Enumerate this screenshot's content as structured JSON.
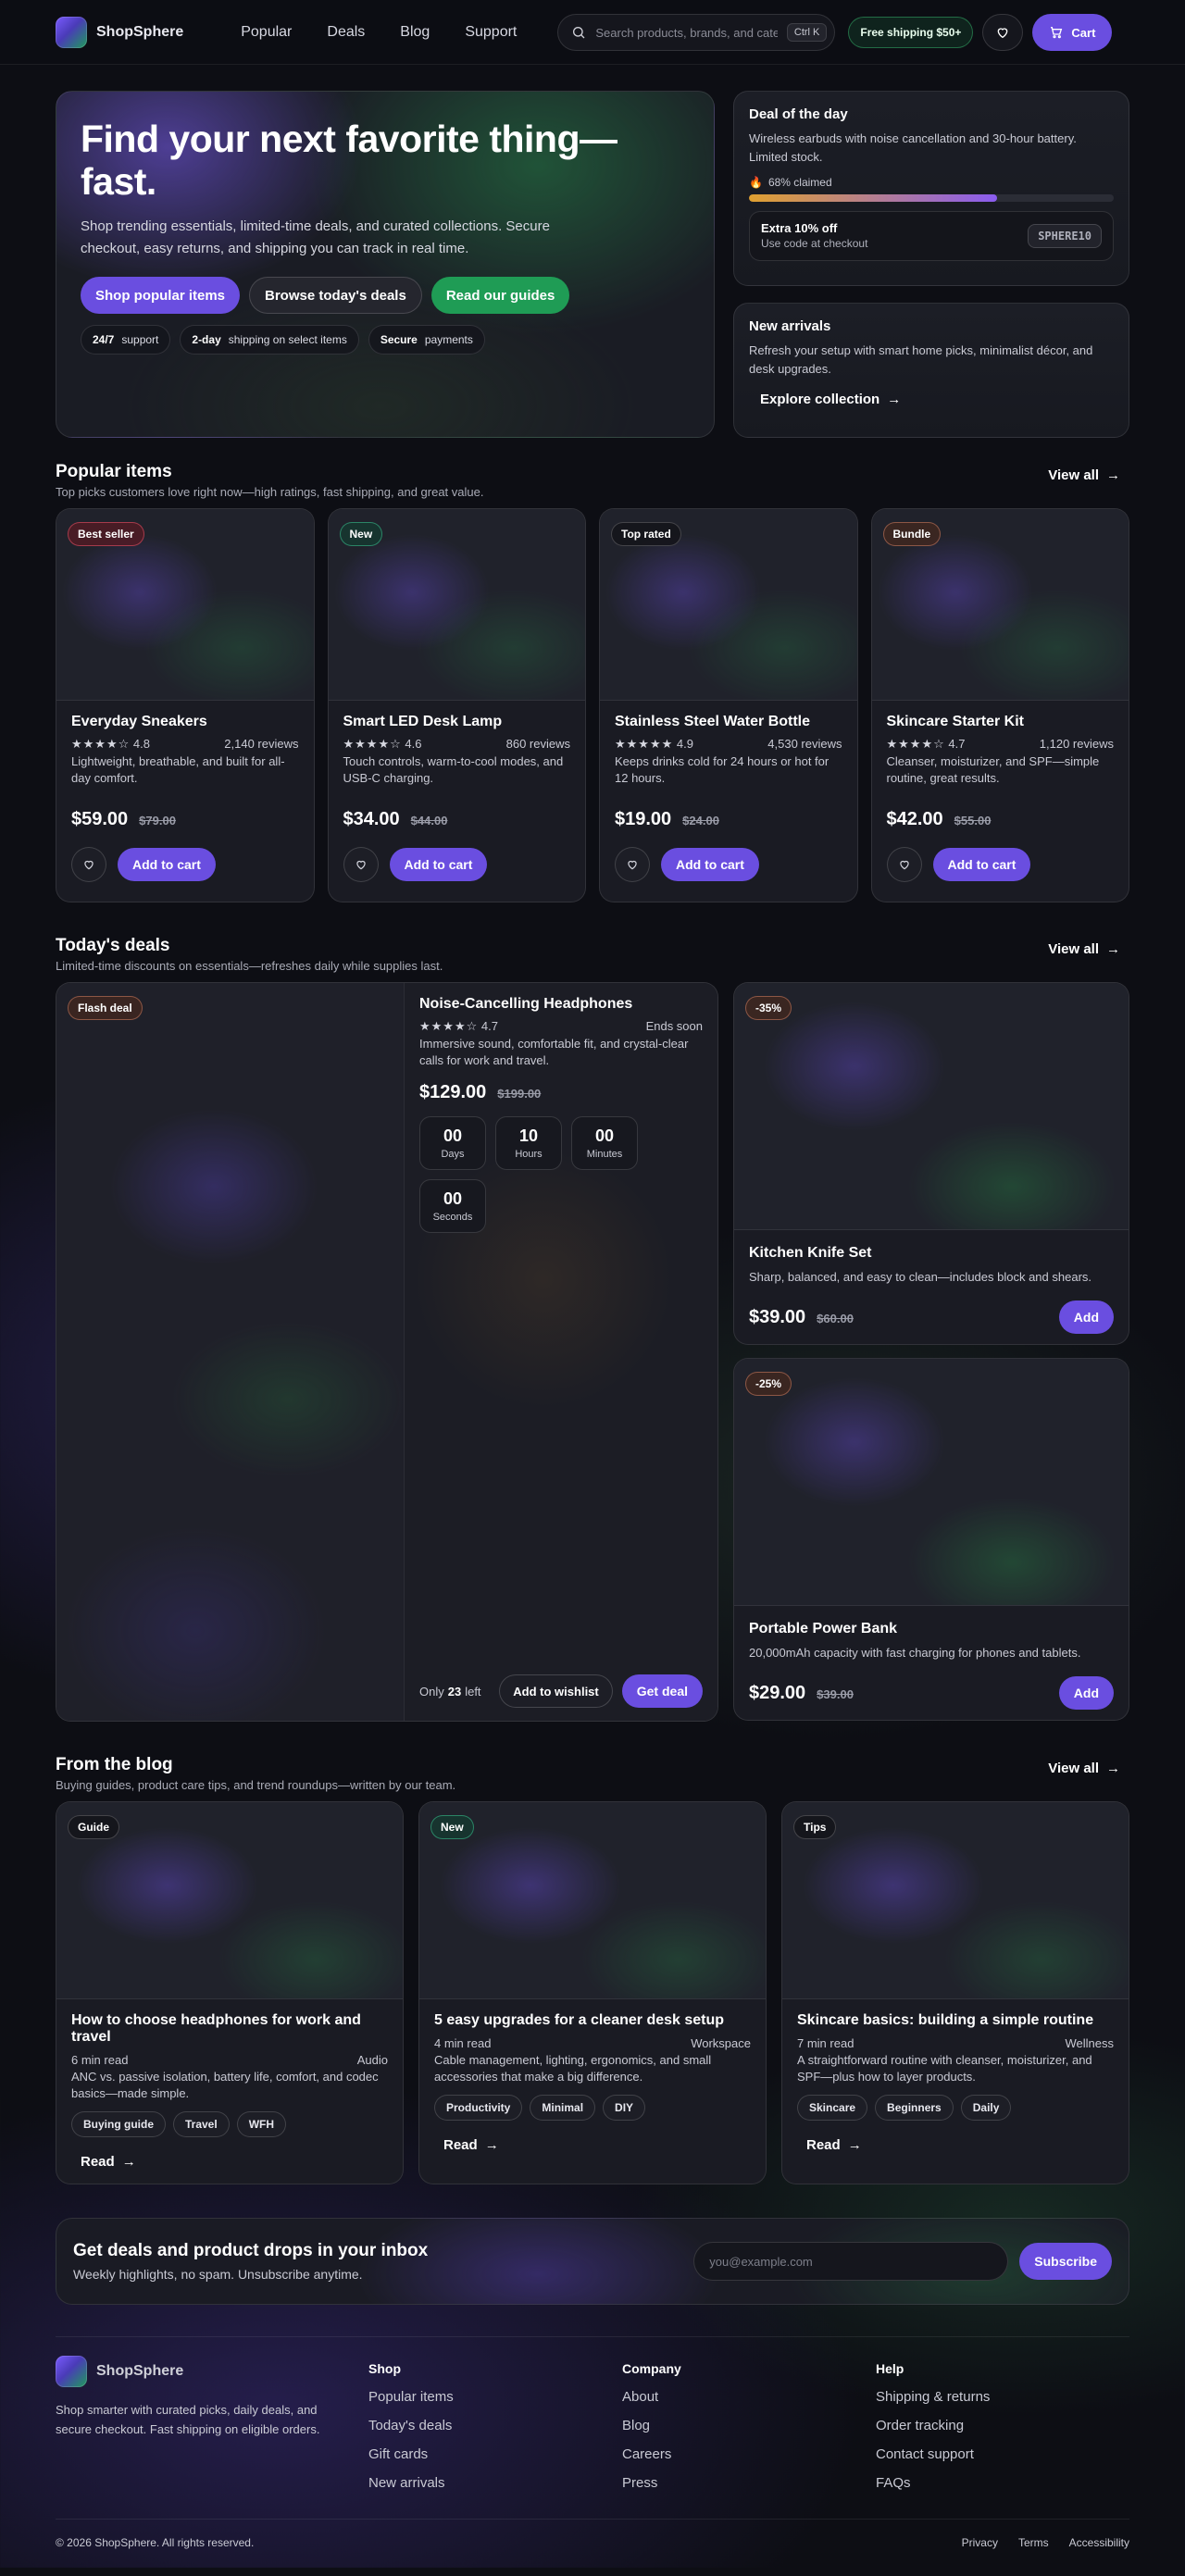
{
  "header": {
    "brand": "ShopSphere",
    "nav": [
      "Popular",
      "Deals",
      "Blog",
      "Support"
    ],
    "search_placeholder": "Search products, brands, and categories",
    "search_shortcut": "Ctrl K",
    "shipping_badge": "Free shipping $50+",
    "cart_label": "Cart"
  },
  "hero": {
    "title": "Find your next favorite thing—fast.",
    "text": "Shop trending essentials, limited-time deals, and curated collections. Secure checkout, easy returns, and shipping you can track in real time.",
    "buttons": [
      "Shop popular items",
      "Browse today's deals",
      "Read our guides"
    ],
    "pills": [
      {
        "strong": "24/7",
        "text": "support"
      },
      {
        "strong": "2-day",
        "text": "shipping on select items"
      },
      {
        "strong": "Secure",
        "text": "payments"
      }
    ]
  },
  "deal_of_day": {
    "title": "Deal of the day",
    "text": "Wireless earbuds with noise cancellation and 30-hour battery. Limited stock.",
    "claimed_label": "68% claimed",
    "claimed_fraction": 0.68,
    "promo_title": "Extra 10% off",
    "promo_sub": "Use code at checkout",
    "promo_code": "SPHERE10"
  },
  "new_arrivals": {
    "title": "New arrivals",
    "text": "Refresh your setup with smart home picks, minimalist décor, and desk upgrades.",
    "link": "Explore collection"
  },
  "popular": {
    "title": "Popular items",
    "subtitle": "Top picks customers love right now—high ratings, fast shipping, and great value.",
    "view_all": "View all",
    "items": [
      {
        "badge": "Best seller",
        "name": "Everyday Sneakers",
        "stars": "★★★★☆",
        "rating": "4.8",
        "reviews": "2,140 reviews",
        "desc": "Lightweight, breathable, and built for all-day comfort.",
        "price": "$59.00",
        "old_price": "$79.00",
        "cta": "Add to cart"
      },
      {
        "badge": "New",
        "name": "Smart LED Desk Lamp",
        "stars": "★★★★☆",
        "rating": "4.6",
        "reviews": "860 reviews",
        "desc": "Touch controls, warm-to-cool modes, and USB-C charging.",
        "price": "$34.00",
        "old_price": "$44.00",
        "cta": "Add to cart"
      },
      {
        "badge": "Top rated",
        "name": "Stainless Steel Water Bottle",
        "stars": "★★★★★",
        "rating": "4.9",
        "reviews": "4,530 reviews",
        "desc": "Keeps drinks cold for 24 hours or hot for 12 hours.",
        "price": "$19.00",
        "old_price": "$24.00",
        "cta": "Add to cart"
      },
      {
        "badge": "Bundle",
        "name": "Skincare Starter Kit",
        "stars": "★★★★☆",
        "rating": "4.7",
        "reviews": "1,120 reviews",
        "desc": "Cleanser, moisturizer, and SPF—simple routine, great results.",
        "price": "$42.00",
        "old_price": "$55.00",
        "cta": "Add to cart"
      }
    ]
  },
  "deals": {
    "title": "Today's deals",
    "subtitle": "Limited-time discounts on essentials—refreshes daily while supplies last.",
    "view_all": "View all",
    "flash": {
      "badge": "Flash deal",
      "name": "Noise-Cancelling Headphones",
      "stars": "★★★★☆",
      "rating": "4.7",
      "ends": "Ends soon",
      "desc": "Immersive sound, comfortable fit, and crystal-clear calls for work and travel.",
      "price": "$129.00",
      "old_price": "$199.00",
      "countdown": [
        {
          "value": "00",
          "label": "Days"
        },
        {
          "value": "10",
          "label": "Hours"
        },
        {
          "value": "00",
          "label": "Minutes"
        },
        {
          "value": "00",
          "label": "Seconds"
        }
      ],
      "only": "Only",
      "stock": "23",
      "left": "left",
      "wishlist": "Add to wishlist",
      "cta": "Get deal"
    },
    "items": [
      {
        "badge": "-35%",
        "name": "Kitchen Knife Set",
        "desc": "Sharp, balanced, and easy to clean—includes block and shears.",
        "price": "$39.00",
        "old_price": "$60.00",
        "cta": "Add"
      },
      {
        "badge": "-25%",
        "name": "Portable Power Bank",
        "desc": "20,000mAh capacity with fast charging for phones and tablets.",
        "price": "$29.00",
        "old_price": "$39.00",
        "cta": "Add"
      }
    ]
  },
  "blog": {
    "title": "From the blog",
    "subtitle": "Buying guides, product care tips, and trend roundups—written by our team.",
    "view_all": "View all",
    "posts": [
      {
        "badge": "Guide",
        "title": "How to choose headphones for work and travel",
        "read_time": "6 min read",
        "category": "Audio",
        "desc": "ANC vs. passive isolation, battery life, comfort, and codec basics—made simple.",
        "tags": [
          "Buying guide",
          "Travel",
          "WFH"
        ],
        "cta": "Read"
      },
      {
        "badge": "New",
        "title": "5 easy upgrades for a cleaner desk setup",
        "read_time": "4 min read",
        "category": "Workspace",
        "desc": "Cable management, lighting, ergonomics, and small accessories that make a big difference.",
        "tags": [
          "Productivity",
          "Minimal",
          "DIY"
        ],
        "cta": "Read"
      },
      {
        "badge": "Tips",
        "title": "Skincare basics: building a simple routine",
        "read_time": "7 min read",
        "category": "Wellness",
        "desc": "A straightforward routine with cleanser, moisturizer, and SPF—plus how to layer products.",
        "tags": [
          "Skincare",
          "Beginners",
          "Daily"
        ],
        "cta": "Read"
      }
    ]
  },
  "newsletter": {
    "title": "Get deals and product drops in your inbox",
    "text": "Weekly highlights, no spam. Unsubscribe anytime.",
    "placeholder": "you@example.com",
    "button": "Subscribe"
  },
  "footer": {
    "brand": "ShopSphere",
    "text": "Shop smarter with curated picks, daily deals, and secure checkout. Fast shipping on eligible orders.",
    "columns": [
      {
        "title": "Shop",
        "links": [
          "Popular items",
          "Today's deals",
          "Gift cards",
          "New arrivals"
        ]
      },
      {
        "title": "Company",
        "links": [
          "About",
          "Blog",
          "Careers",
          "Press"
        ]
      },
      {
        "title": "Help",
        "links": [
          "Shipping & returns",
          "Order tracking",
          "Contact support",
          "FAQs"
        ]
      }
    ],
    "copyright": "© 2026 ShopSphere. All rights reserved.",
    "legal": [
      "Privacy",
      "Terms",
      "Accessibility"
    ]
  }
}
